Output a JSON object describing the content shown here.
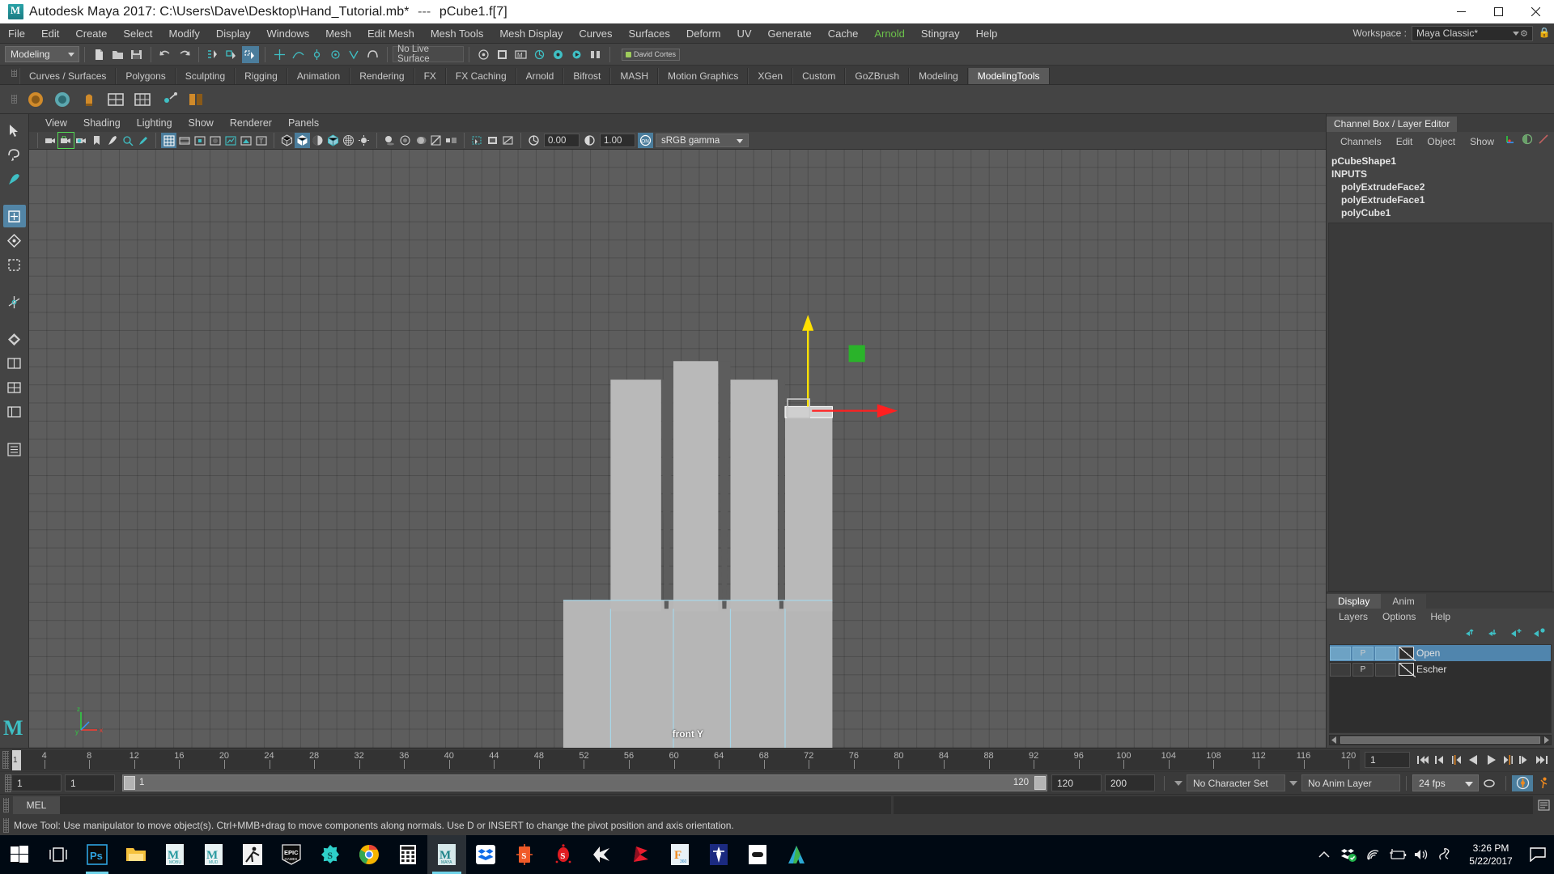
{
  "titlebar": {
    "app_title": "Autodesk Maya 2017: C:\\Users\\Dave\\Desktop\\Hand_Tutorial.mb*",
    "separator": "---",
    "selection": "pCube1.f[7]",
    "minimize": "—",
    "maximize": "❐",
    "close": "✕",
    "logo_letter": "M"
  },
  "menubar": {
    "items": [
      {
        "label": "File"
      },
      {
        "label": "Edit"
      },
      {
        "label": "Create"
      },
      {
        "label": "Select"
      },
      {
        "label": "Modify"
      },
      {
        "label": "Display"
      },
      {
        "label": "Windows"
      },
      {
        "label": "Mesh"
      },
      {
        "label": "Edit Mesh"
      },
      {
        "label": "Mesh Tools"
      },
      {
        "label": "Mesh Display"
      },
      {
        "label": "Curves"
      },
      {
        "label": "Surfaces"
      },
      {
        "label": "Deform"
      },
      {
        "label": "UV"
      },
      {
        "label": "Generate"
      },
      {
        "label": "Cache"
      },
      {
        "label": "Arnold",
        "highlight": true
      },
      {
        "label": "Stingray"
      },
      {
        "label": "Help"
      }
    ],
    "workspace_label": "Workspace :",
    "workspace_value": "Maya Classic*"
  },
  "statusline": {
    "mode": "Modeling",
    "live_surface": "No Live Surface",
    "user_badge": "David Cortes"
  },
  "shelf": {
    "tabs": [
      {
        "label": "Curves / Surfaces"
      },
      {
        "label": "Polygons"
      },
      {
        "label": "Sculpting"
      },
      {
        "label": "Rigging"
      },
      {
        "label": "Animation"
      },
      {
        "label": "Rendering"
      },
      {
        "label": "FX"
      },
      {
        "label": "FX Caching"
      },
      {
        "label": "Arnold"
      },
      {
        "label": "Bifrost"
      },
      {
        "label": "MASH"
      },
      {
        "label": "Motion Graphics"
      },
      {
        "label": "XGen"
      },
      {
        "label": "Custom"
      },
      {
        "label": "GoZBrush"
      },
      {
        "label": "Modeling"
      },
      {
        "label": "ModelingTools",
        "active": true
      }
    ]
  },
  "viewport": {
    "menus": [
      {
        "label": "View"
      },
      {
        "label": "Shading"
      },
      {
        "label": "Lighting"
      },
      {
        "label": "Show"
      },
      {
        "label": "Renderer"
      },
      {
        "label": "Panels"
      }
    ],
    "exposure_value": "0.00",
    "gamma_value": "1.00",
    "color_management": "sRGB gamma",
    "view_label": "front Y",
    "axis_x": "x",
    "axis_y": "y",
    "axis_z": "z"
  },
  "channelbox": {
    "tab_title": "Channel Box / Layer Editor",
    "menus": [
      {
        "label": "Channels"
      },
      {
        "label": "Edit"
      },
      {
        "label": "Object"
      },
      {
        "label": "Show"
      }
    ],
    "node_name": "pCubeShape1",
    "inputs_header": "INPUTS",
    "inputs": [
      {
        "label": "polyExtrudeFace2"
      },
      {
        "label": "polyExtrudeFace1"
      },
      {
        "label": "polyCube1"
      }
    ]
  },
  "layer_editor": {
    "tabs": [
      {
        "label": "Display",
        "active": true
      },
      {
        "label": "Anim",
        "active": false
      }
    ],
    "menus": [
      {
        "label": "Layers"
      },
      {
        "label": "Options"
      },
      {
        "label": "Help"
      }
    ],
    "layers": [
      {
        "name": "Open",
        "visibility": "",
        "playback": "P",
        "state": "",
        "selected": true
      },
      {
        "name": "Escher",
        "visibility": "",
        "playback": "P",
        "state": "",
        "selected": false
      }
    ]
  },
  "timeline": {
    "ticks": [
      4,
      8,
      12,
      16,
      20,
      24,
      28,
      32,
      36,
      40,
      44,
      48,
      52,
      56,
      60,
      64,
      68,
      72,
      76,
      80,
      84,
      88,
      92,
      96,
      100,
      104,
      108,
      112,
      116,
      120
    ],
    "current_frame_marker": "1",
    "current_frame_field": "1"
  },
  "range": {
    "anim_start": "1",
    "range_start": "1",
    "slider_start_label": "1",
    "slider_end_label": "120",
    "range_end": "120",
    "anim_end": "200",
    "character_set": "No Character Set",
    "anim_layer": "No Anim Layer",
    "fps": "24 fps"
  },
  "command_line": {
    "tab_label": "MEL",
    "input_value": "",
    "placeholder": ""
  },
  "help_line": {
    "text": "Move Tool: Use manipulator to move object(s). Ctrl+MMB+drag to move components along normals. Use D or INSERT to change the pivot position and axis orientation."
  },
  "taskbar": {
    "items": [
      {
        "name": "start-button",
        "label": "Start"
      },
      {
        "name": "task-view-button",
        "label": "Task View"
      },
      {
        "name": "photoshop",
        "label": "Ps"
      },
      {
        "name": "file-explorer",
        "label": "File Explorer"
      },
      {
        "name": "mudbox",
        "label": "MUDB"
      },
      {
        "name": "mudbox2",
        "label": "MUD"
      },
      {
        "name": "motionbuilder",
        "label": "MotionBuilder"
      },
      {
        "name": "epic-games",
        "label": "EPIC GAMES"
      },
      {
        "name": "substance",
        "label": "S"
      },
      {
        "name": "chrome",
        "label": "Chrome"
      },
      {
        "name": "calculator",
        "label": "Calculator"
      },
      {
        "name": "maya",
        "label": "MAYA"
      },
      {
        "name": "dropbox",
        "label": "Dropbox"
      },
      {
        "name": "substance-painter",
        "label": "S"
      },
      {
        "name": "substance-designer",
        "label": "S"
      },
      {
        "name": "unity",
        "label": "Unity"
      },
      {
        "name": "marmoset",
        "label": "Marmoset"
      },
      {
        "name": "fusion360",
        "label": "F 360"
      },
      {
        "name": "zbrush",
        "label": "ZBrush"
      },
      {
        "name": "oculus",
        "label": "Oculus"
      },
      {
        "name": "autodesk",
        "label": "Autodesk"
      }
    ],
    "tray": {
      "chevron": "⌃",
      "time": "3:26 PM",
      "date": "5/22/2017"
    }
  },
  "colors": {
    "accent_blue": "#5285a6",
    "highlight_cyan": "#4bbdd4",
    "arnold_green": "#6cc24a",
    "manipulator_red": "#ff0000",
    "manipulator_green": "#00c000",
    "manipulator_yellow": "#ffe100",
    "layer_selected": "#5085ad",
    "viewport_bg": "#5d5d5d",
    "mesh_fill": "#b5b5b5",
    "mesh_edge": "#9fd4e8"
  }
}
